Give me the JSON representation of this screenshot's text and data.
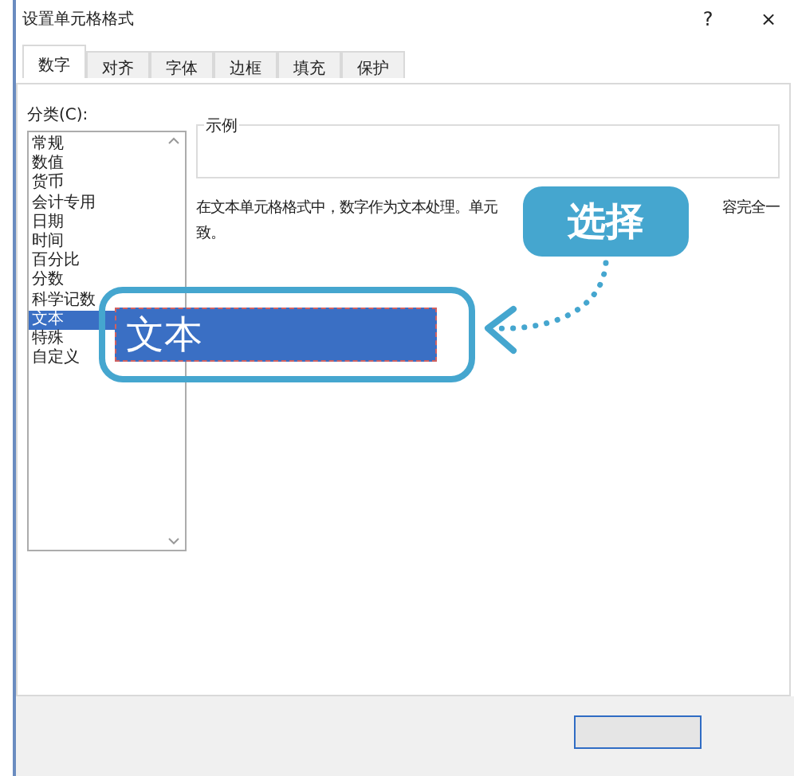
{
  "window": {
    "title": "设置单元格格式",
    "help": "?",
    "close": "×"
  },
  "tabs": [
    {
      "label": "数字",
      "selected": true
    },
    {
      "label": "对齐",
      "selected": false
    },
    {
      "label": "字体",
      "selected": false
    },
    {
      "label": "边框",
      "selected": false
    },
    {
      "label": "填充",
      "selected": false
    },
    {
      "label": "保护",
      "selected": false
    }
  ],
  "category": {
    "label": "分类(C):",
    "items": [
      {
        "label": "常规",
        "selected": false
      },
      {
        "label": "数值",
        "selected": false
      },
      {
        "label": "货币",
        "selected": false
      },
      {
        "label": "会计专用",
        "selected": false
      },
      {
        "label": "日期",
        "selected": false
      },
      {
        "label": "时间",
        "selected": false
      },
      {
        "label": "百分比",
        "selected": false
      },
      {
        "label": "分数",
        "selected": false
      },
      {
        "label": "科学记数",
        "selected": false
      },
      {
        "label": "文本",
        "selected": true
      },
      {
        "label": "特殊",
        "selected": false
      },
      {
        "label": "自定义",
        "selected": false
      }
    ]
  },
  "sample": {
    "label": "示例"
  },
  "description": {
    "line_1_start": "在文本单元格格式中，数字作为文本处理。单元",
    "line_1_end": "容完全一",
    "line_2": "致。"
  },
  "magnifier": {
    "text": "文本"
  },
  "callout": {
    "text": "选择"
  }
}
